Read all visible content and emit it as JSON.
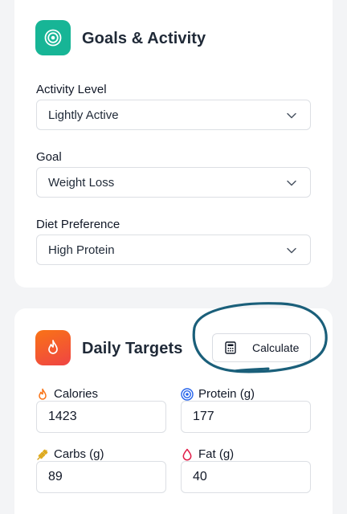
{
  "goals_card": {
    "title": "Goals & Activity",
    "fields": [
      {
        "label": "Activity Level",
        "value": "Lightly Active"
      },
      {
        "label": "Goal",
        "value": "Weight Loss"
      },
      {
        "label": "Diet Preference",
        "value": "High Protein"
      }
    ]
  },
  "targets_card": {
    "title": "Daily Targets",
    "calculate_label": "Calculate",
    "fields": [
      {
        "label": "Calories",
        "value": "1423",
        "icon": "flame-icon"
      },
      {
        "label": "Protein (g)",
        "value": "177",
        "icon": "target-icon"
      },
      {
        "label": "Carbs (g)",
        "value": "89",
        "icon": "wheat-icon"
      },
      {
        "label": "Fat (g)",
        "value": "40",
        "icon": "droplet-icon"
      }
    ]
  },
  "colors": {
    "teal_accent": "#17b596",
    "orange_accent": "#f97316",
    "annotation_ink": "#1a5f7a"
  }
}
